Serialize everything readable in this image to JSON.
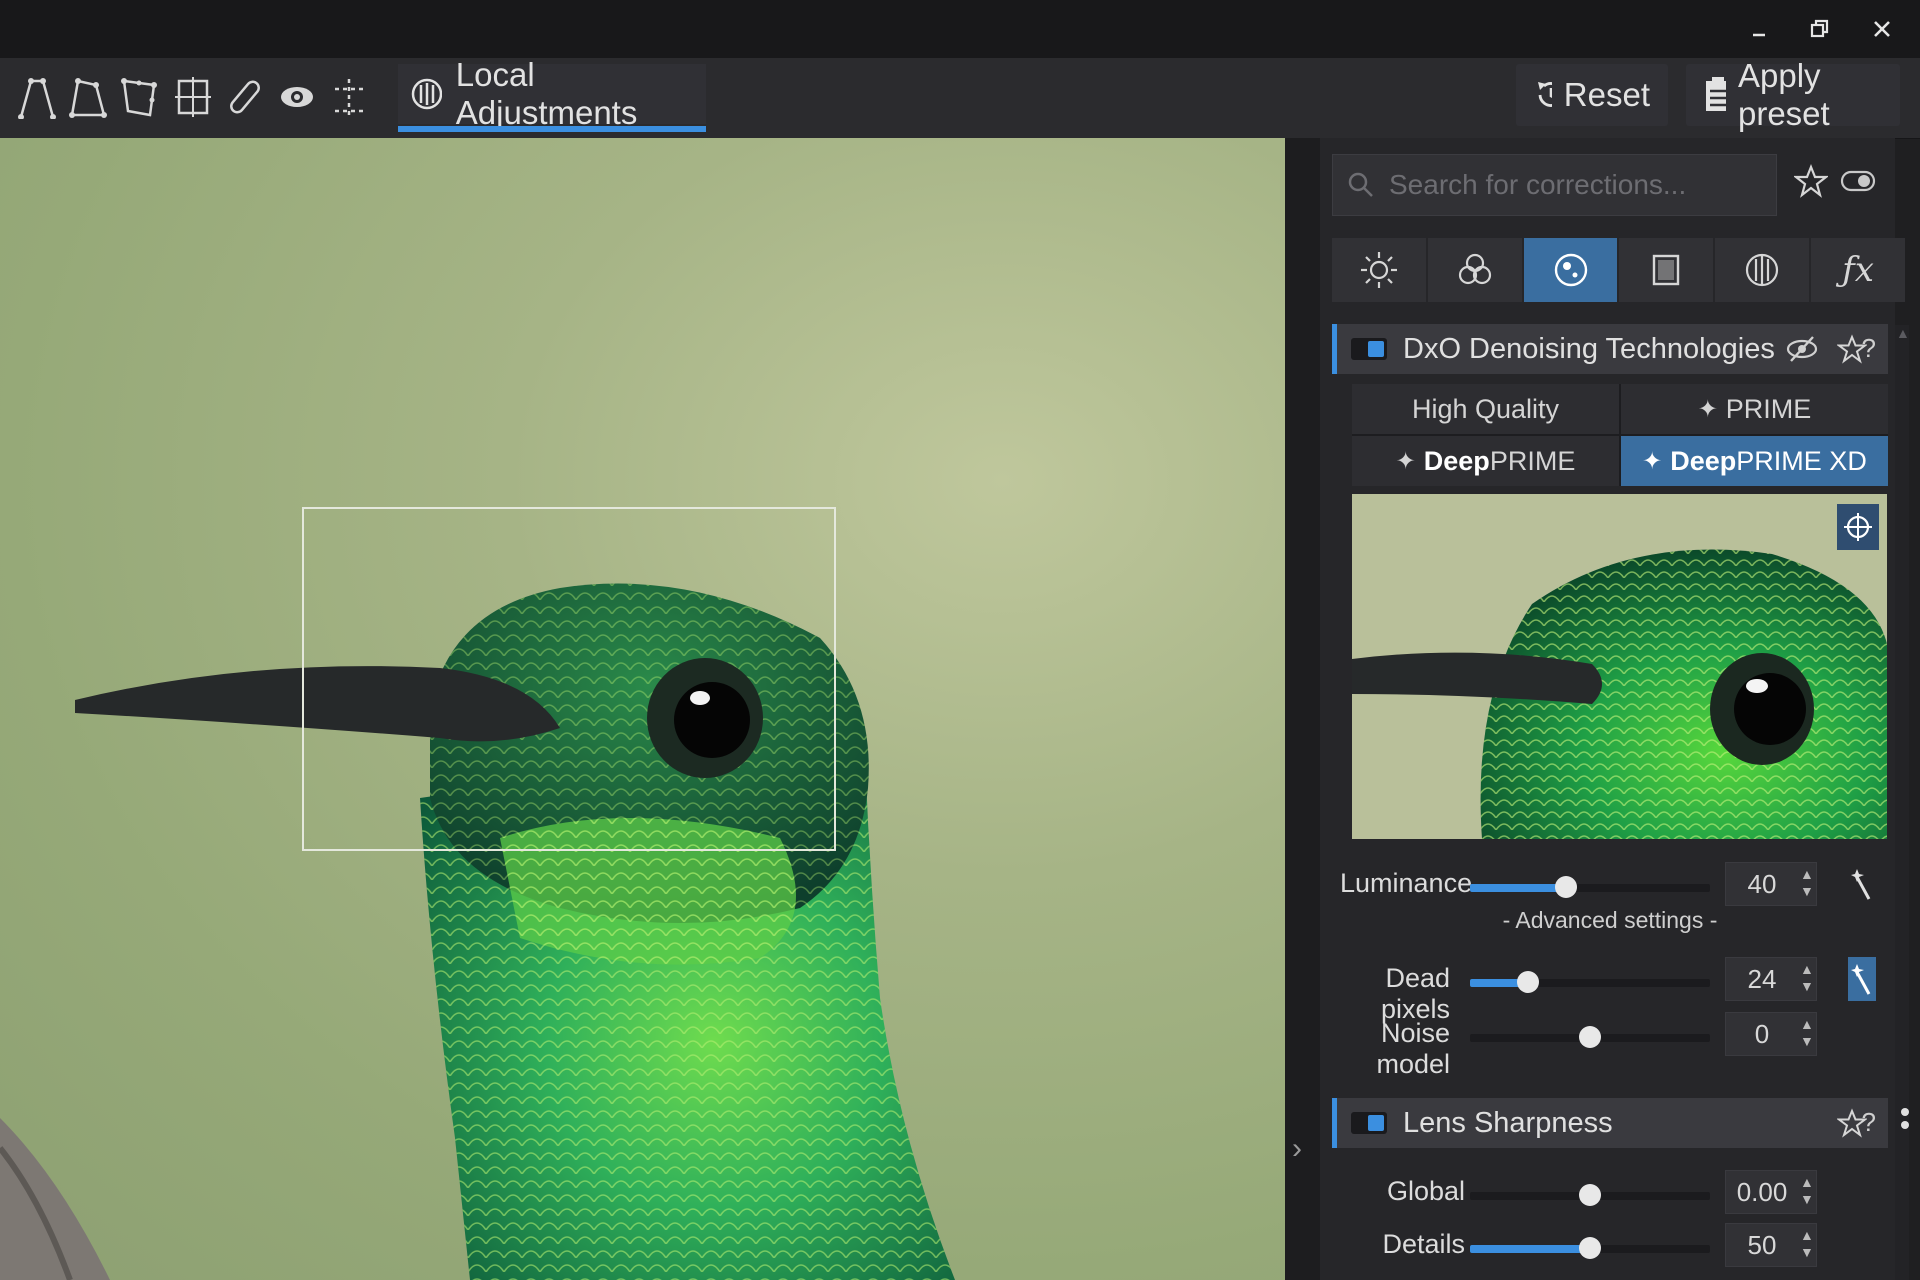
{
  "toolbar": {
    "local_adjustments_label": "Local Adjustments",
    "reset_label": "Reset",
    "apply_preset_label": "Apply preset"
  },
  "search": {
    "placeholder": "Search for corrections..."
  },
  "category_tabs": [
    {
      "icon": "sun-icon",
      "active": false
    },
    {
      "icon": "color-circles-icon",
      "active": false
    },
    {
      "icon": "detail-circle-icon",
      "active": true
    },
    {
      "icon": "geometry-frame-icon",
      "active": false
    },
    {
      "icon": "local-adjust-icon",
      "active": false
    },
    {
      "icon": "fx-icon",
      "active": false
    }
  ],
  "denoise": {
    "title": "DxO Denoising Technologies",
    "modes": {
      "high_quality": "High Quality",
      "prime": "PRIME",
      "deep_prefix": "Deep",
      "deepprime_suffix": "PRIME",
      "deepprime_xd_suffix": "PRIME XD",
      "selected": "DeepPRIME XD"
    },
    "luminance": {
      "label": "Luminance",
      "value": "40",
      "fraction": 0.4
    },
    "advanced_label": "- Advanced settings -",
    "dead_pixels": {
      "label": "Dead pixels",
      "value": "24",
      "fraction": 0.24
    },
    "noise_model": {
      "label": "Noise model",
      "value": "0",
      "fraction": 0.5
    }
  },
  "lens_sharpness": {
    "title": "Lens Sharpness",
    "global": {
      "label": "Global",
      "value": "0.00",
      "fraction": 0.5
    },
    "details": {
      "label": "Details",
      "value": "50",
      "fraction": 0.5
    }
  },
  "colors": {
    "accent": "#3b8fe0",
    "active_tab": "#3a6ea0",
    "panel_bg": "#262629"
  }
}
